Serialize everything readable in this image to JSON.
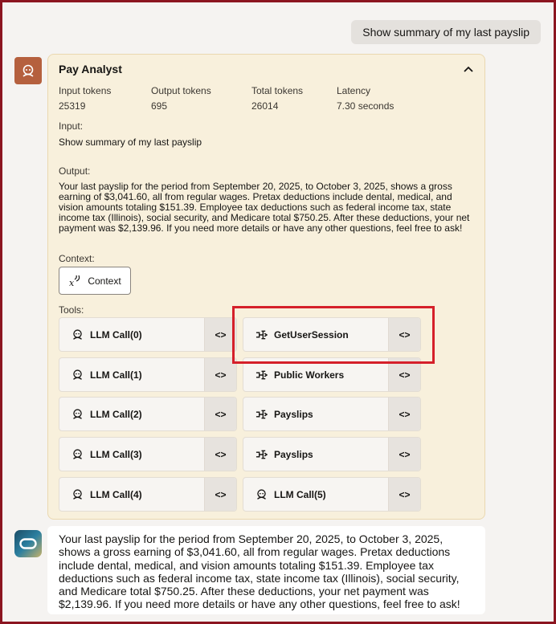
{
  "user_message": "Show summary of my last payslip",
  "panel": {
    "title": "Pay Analyst",
    "stats": [
      {
        "label": "Input tokens",
        "value": "25319"
      },
      {
        "label": "Output tokens",
        "value": "695"
      },
      {
        "label": "Total tokens",
        "value": "26014"
      },
      {
        "label": "Latency",
        "value": "7.30 seconds"
      }
    ],
    "input_label": "Input:",
    "input_text": "Show summary of my last payslip",
    "output_label": "Output:",
    "output_text": "Your last payslip for the period from September 20, 2025, to October 3, 2025, shows a gross earning of $3,041.60, all from regular wages. Pretax deductions include dental, medical, and vision amounts totaling $151.39. Employee tax deductions such as federal income tax, state income tax (Illinois), social security, and Medicare total $750.25. After these deductions, your net payment was $2,139.96. If you need more details or have any other questions, feel free to ask!",
    "context_label": "Context:",
    "context_button": "Context",
    "tools_label": "Tools:",
    "code_glyph": "<>",
    "tools": [
      {
        "label": "LLM Call(0)",
        "icon": "llm-icon"
      },
      {
        "label": "GetUserSession",
        "icon": "tool-function-icon"
      },
      {
        "label": "LLM Call(1)",
        "icon": "llm-icon"
      },
      {
        "label": "Public Workers",
        "icon": "tool-function-icon"
      },
      {
        "label": "LLM Call(2)",
        "icon": "llm-icon"
      },
      {
        "label": "Payslips",
        "icon": "tool-function-icon"
      },
      {
        "label": "LLM Call(3)",
        "icon": "llm-icon"
      },
      {
        "label": "Payslips",
        "icon": "tool-function-icon"
      },
      {
        "label": "LLM Call(4)",
        "icon": "llm-icon"
      },
      {
        "label": "LLM Call(5)",
        "icon": "llm-icon"
      }
    ]
  },
  "answer_text": "Your last payslip for the period from September 20, 2025, to October 3, 2025, shows a gross earning of $3,041.60, all from regular wages. Pretax deductions include dental, medical, and vision amounts totaling $151.39. Employee tax deductions such as federal income tax, state income tax (Illinois), social security, and Medicare total $750.25. After these deductions, your net payment was $2,139.96. If you need more details or have any other questions, feel free to ask!",
  "colors": {
    "frame_border": "#8b1520",
    "agent_avatar": "#b5603e",
    "panel_bg": "#f8f0dc",
    "highlight": "#d5202a"
  }
}
